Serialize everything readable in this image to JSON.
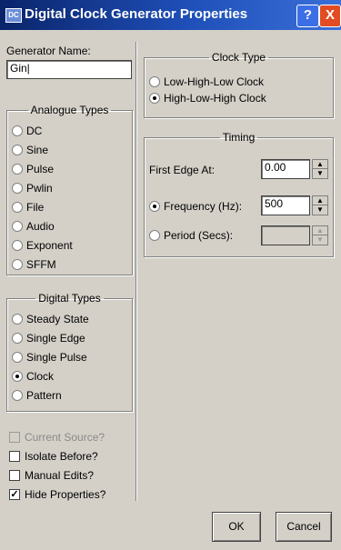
{
  "window": {
    "title": "Digital Clock Generator Properties",
    "icon_text": "DC",
    "help_label": "?",
    "close_label": "X"
  },
  "generator": {
    "name_label": "Generator Name:",
    "name_value": "Gin|"
  },
  "analogue": {
    "legend": "Analogue Types",
    "items": [
      "DC",
      "Sine",
      "Pulse",
      "Pwlin",
      "File",
      "Audio",
      "Exponent",
      "SFFM"
    ]
  },
  "digital": {
    "legend": "Digital Types",
    "items": [
      "Steady State",
      "Single Edge",
      "Single Pulse",
      "Clock",
      "Pattern"
    ],
    "selected": "Clock"
  },
  "options": {
    "current_source": "Current Source?",
    "isolate_before": "Isolate Before?",
    "manual_edits": "Manual Edits?",
    "hide_properties": "Hide Properties?"
  },
  "clock_type": {
    "legend": "Clock Type",
    "options": [
      "Low-High-Low Clock",
      "High-Low-High Clock"
    ],
    "selected": "High-Low-High Clock"
  },
  "timing": {
    "legend": "Timing",
    "first_edge_label": "First Edge At:",
    "first_edge_value": "0.00",
    "frequency_label": "Frequency (Hz):",
    "frequency_value": "500",
    "period_label": "Period (Secs):",
    "period_value": ""
  },
  "buttons": {
    "ok": "OK",
    "cancel": "Cancel"
  }
}
